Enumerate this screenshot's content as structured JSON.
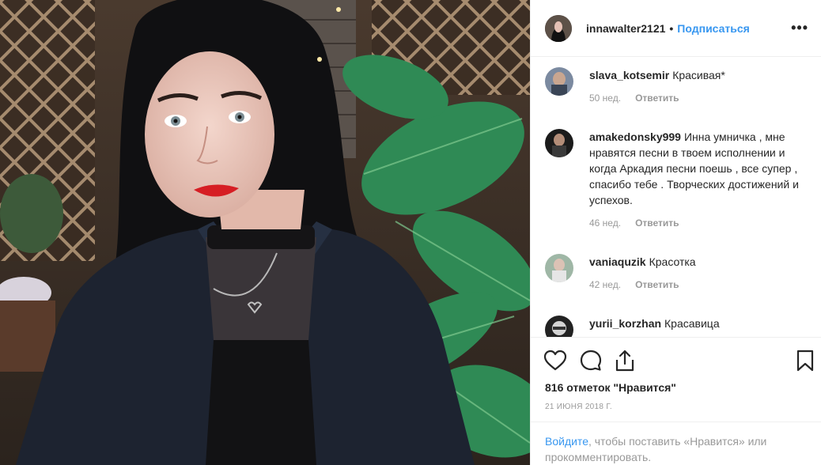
{
  "header": {
    "username": "innawalter2121",
    "separator": "•",
    "follow_label": "Подписаться",
    "more_label": "•••"
  },
  "comments": [
    {
      "username": "slava_kotsemir",
      "text": "Красивая*",
      "age": "50 нед.",
      "reply_label": "Ответить"
    },
    {
      "username": "amakedonsky999",
      "text": "Инна умничка , мне нравятся песни в твоем исполнении и когда Аркадия песни поешь , все супер , спасибо тебе . Творческих достижений и успехов.",
      "age": "46 нед.",
      "reply_label": "Ответить"
    },
    {
      "username": "vaniaquzik",
      "text": "Красотка",
      "age": "42 нед.",
      "reply_label": "Ответить"
    },
    {
      "username": "yurii_korzhan",
      "text": "Красавица",
      "age": "",
      "reply_label": ""
    }
  ],
  "actions": {
    "icons": [
      "heart-icon",
      "comment-icon",
      "share-icon",
      "bookmark-icon"
    ]
  },
  "likes": "816 отметок \"Нравится\"",
  "date": "21 июня 2018 г.",
  "login_prompt": {
    "link": "Войдите",
    "rest": ", чтобы поставить «Нравится» или прокомментировать."
  },
  "colors": {
    "link_blue": "#3897f0",
    "text": "#262626",
    "muted": "#999999",
    "divider": "#efefef"
  }
}
